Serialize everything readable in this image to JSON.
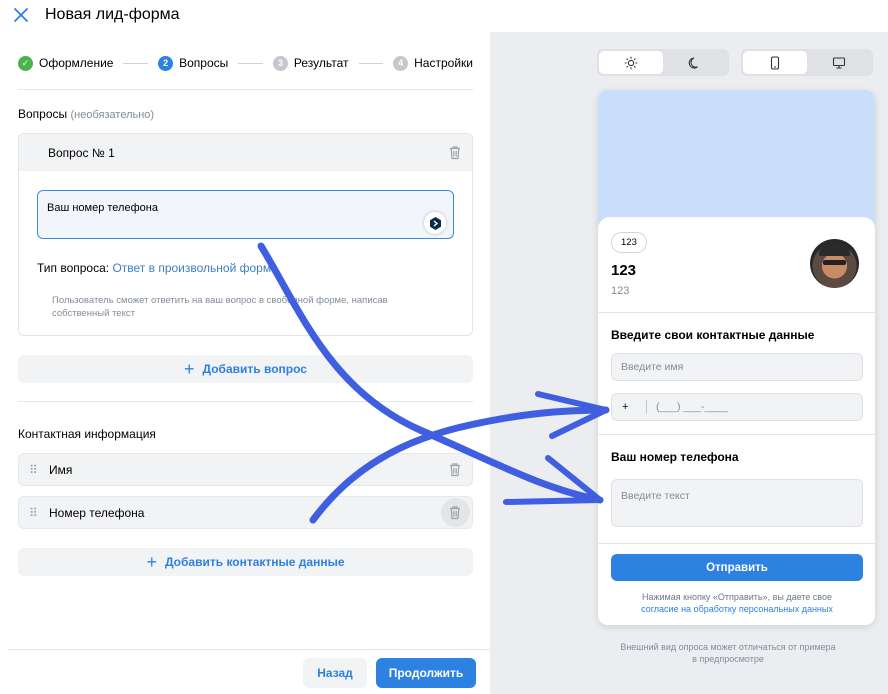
{
  "header": {
    "title": "Новая лид-форма",
    "close_icon": "close-icon"
  },
  "steps": [
    {
      "label": "Оформление",
      "state": "done",
      "marker": "✓"
    },
    {
      "label": "Вопросы",
      "state": "active",
      "marker": "2"
    },
    {
      "label": "Результат",
      "state": "pending",
      "marker": "3"
    },
    {
      "label": "Настройки",
      "state": "pending",
      "marker": "4"
    }
  ],
  "questions": {
    "section_label": "Вопросы",
    "section_note": "(необязательно)",
    "card_title": "Вопрос № 1",
    "input_value": "Ваш номер телефона",
    "type_label": "Тип вопроса:",
    "type_value": "Ответ в произвольной форме",
    "hint": "Пользователь сможет ответить на ваш вопрос в свободной форме, написав собственный текст",
    "add_label": "Добавить вопрос"
  },
  "contacts": {
    "section_label": "Контактная информация",
    "rows": [
      "Имя",
      "Номер телефона"
    ],
    "add_label": "Добавить контактные данные"
  },
  "footer": {
    "back_label": "Назад",
    "next_label": "Продолжить"
  },
  "preview": {
    "pill": "123",
    "title": "123",
    "subtitle": "123",
    "contacts_heading": "Введите свои контактные данные",
    "name_placeholder": "Введите имя",
    "phone_prefix": "+",
    "phone_placeholder": "(___) ___-____",
    "question_heading": "Ваш номер телефона",
    "text_placeholder": "Введите текст",
    "submit_label": "Отправить",
    "consent_text": "Нажимая кнопку «Отправить», вы даете свое",
    "consent_link": "согласие на обработку персональных данных",
    "note": "Внешний вид опроса может отличаться от примера в предпросмотре"
  },
  "colors": {
    "accent": "#2d81e0",
    "done": "#4bb34b",
    "pending": "#c4c8cc",
    "arrow": "#3f5fe0",
    "cover": "#c9defb"
  }
}
